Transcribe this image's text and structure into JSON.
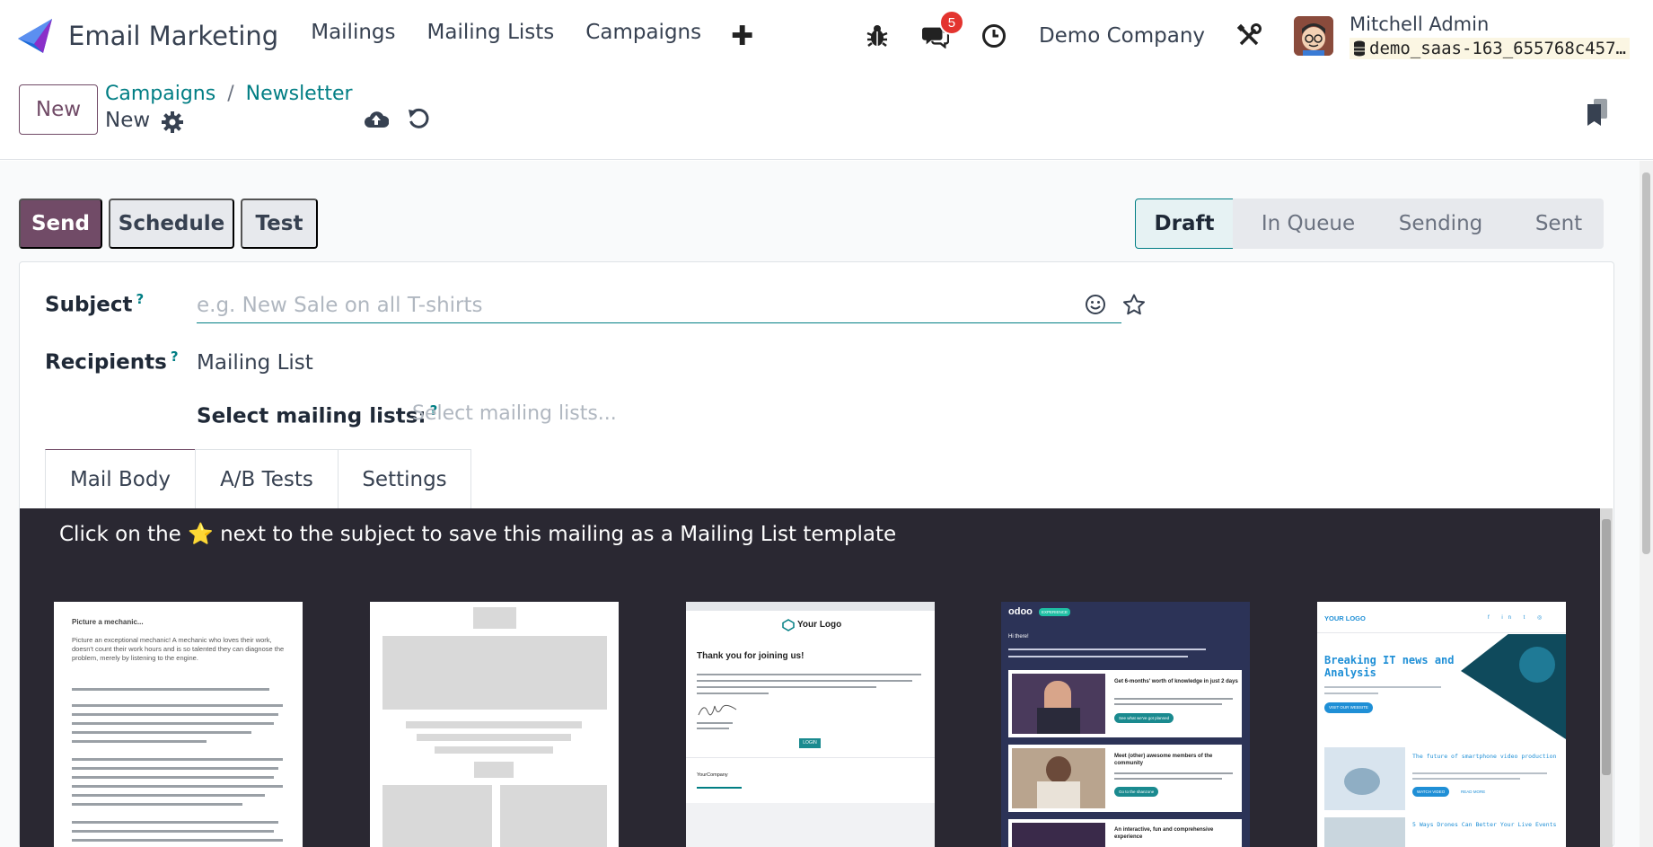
{
  "navbar": {
    "app_name": "Email Marketing",
    "menu": [
      "Mailings",
      "Mailing Lists",
      "Campaigns"
    ],
    "add_icon": "plus-icon",
    "messages_count": "5",
    "company": "Demo Company",
    "user_name": "Mitchell Admin",
    "db_name": "demo_saas-163_655768c457…"
  },
  "control": {
    "new_label": "New",
    "breadcrumb": [
      "Campaigns",
      "Newsletter"
    ],
    "breadcrumb_sep": "/",
    "record_name": "New"
  },
  "actions": {
    "send": "Send",
    "schedule": "Schedule",
    "test": "Test"
  },
  "statusbar": {
    "stages": [
      "Draft",
      "In Queue",
      "Sending",
      "Sent"
    ],
    "active": "Draft"
  },
  "form": {
    "subject_label": "Subject",
    "subject_placeholder": "e.g. New Sale on all T-shirts",
    "subject_value": "",
    "help_mark": "?",
    "recipients_label": "Recipients",
    "recipients_value": "Mailing List",
    "mailing_lists_label": "Select mailing lists:",
    "mailing_lists_placeholder": "Select mailing lists..."
  },
  "tabs": [
    "Mail Body",
    "A/B Tests",
    "Settings"
  ],
  "editor": {
    "hint": "Click on the ⭐ next to the subject to save this mailing as a Mailing List template",
    "templates": {
      "t1": {
        "title": "Picture a mechanic...",
        "para1": "Picture an exceptional mechanic! A mechanic who loves their work, doesn't count their work hours and is so talented they can diagnose the problem, merely by listening to the engine."
      },
      "t3": {
        "logo": "Your Logo",
        "heading": "Thank you for joining us!",
        "button": "LOGIN",
        "footer_company": "YourCompany"
      },
      "t4": {
        "logo": "odoo",
        "tag": "EXPERIENCE",
        "greeting": "Hi there!",
        "item1": "Get 6-months' worth of knowledge in just 2 days",
        "item1_button": "See what we've got planned",
        "item2": "Meet (other) awesome members of the community",
        "item2_button": "Go to the shanzone",
        "item3": "An interactive, fun and comprehensive experience"
      },
      "t5": {
        "logo": "YOUR LOGO",
        "headline": "Breaking IT news and Analysis",
        "button": "VISIT OUR WEBSITE",
        "article1": "The future of smartphone video production",
        "article1_button": "WATCH VIDEO",
        "article1_link": "READ MORE",
        "article2": "5 Ways Drones Can Better Your Live Events"
      }
    }
  },
  "colors": {
    "primary": "#714b67",
    "teal": "#017e84",
    "badge": "#e3342f",
    "editor_bg": "#2a2832"
  }
}
